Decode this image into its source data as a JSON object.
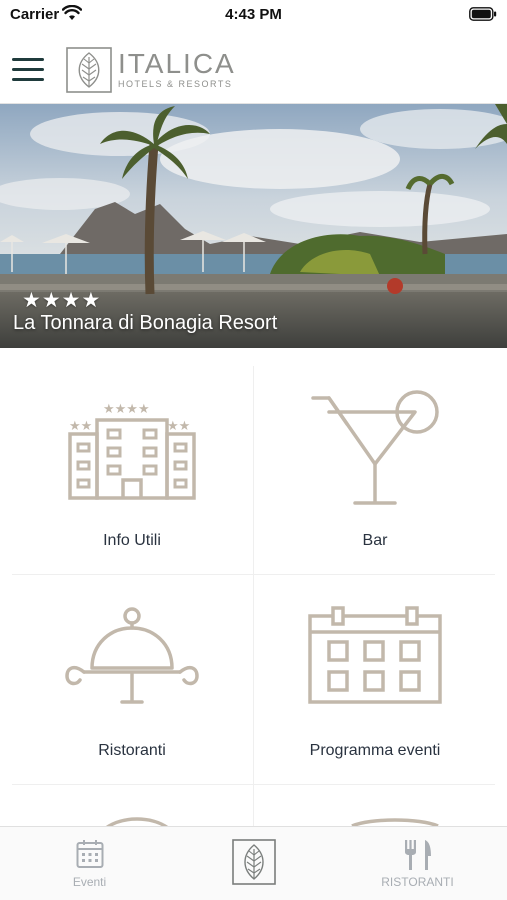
{
  "status_bar": {
    "carrier": "Carrier",
    "time": "4:43 PM"
  },
  "header": {
    "logo_title": "ITALICA",
    "logo_subtitle": "HOTELS & RESORTS",
    "accent_color": "#1f3b3c"
  },
  "hero": {
    "stars": "★★★★",
    "title": "La Tonnara di Bonagia Resort"
  },
  "tiles": [
    {
      "label": "Info Utili",
      "icon": "hotel-building-icon"
    },
    {
      "label": "Bar",
      "icon": "cocktail-glass-icon"
    },
    {
      "label": "Ristoranti",
      "icon": "cloche-icon"
    },
    {
      "label": "Programma eventi",
      "icon": "calendar-icon"
    }
  ],
  "tab_bar": {
    "items": [
      {
        "label": "Eventi",
        "icon": "calendar-icon"
      },
      {
        "label": "",
        "icon": "italica-logo-icon"
      },
      {
        "label": "RISTORANTI",
        "icon": "fork-knife-icon"
      }
    ]
  },
  "colors": {
    "icon_stroke": "#c2b8ab",
    "tab_inactive": "#a8adb3"
  }
}
